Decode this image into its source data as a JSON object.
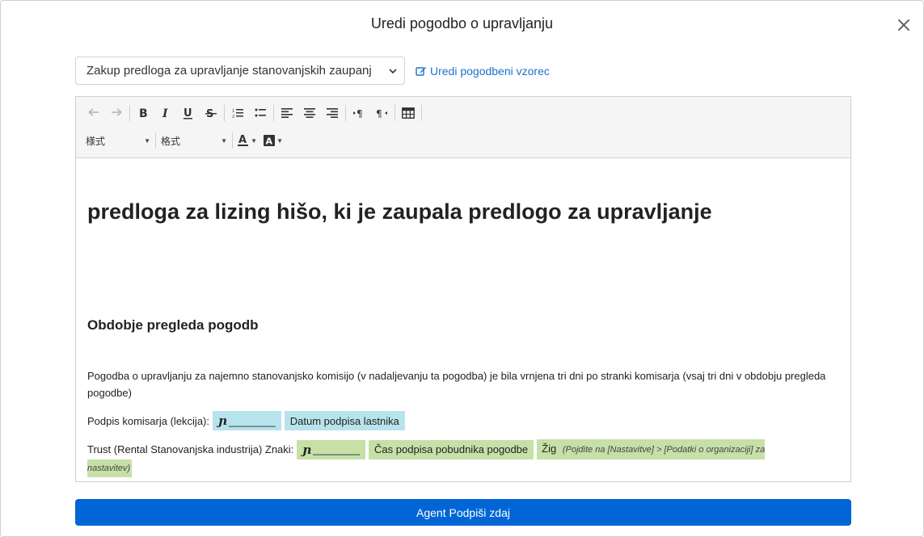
{
  "modal": {
    "title": "Uredi pogodbo o upravljanju",
    "close_icon": "close-icon"
  },
  "template_select": {
    "value": "Zakup predloga za upravljanje stanovanjskih zaupanj",
    "caret_icon": "chevron-down-icon"
  },
  "edit_template_link": {
    "label": "Uredi pogodbeni vzorec",
    "icon": "edit-icon"
  },
  "toolbar": {
    "style_combo": "様式",
    "format_combo": "格式"
  },
  "document": {
    "title": "predloga za lizing hišo, ki je zaupala predlogo za upravljanje",
    "section_heading": "Obdobje pregleda pogodb",
    "paragraph": "Pogodba o upravljanju za najemno stanovanjsko komisijo (v nadaljevanju ta pogodba) je bila vrnjena tri dni po stranki komisarja (vsaj tri dni v obdobju pregleda pogodbe)",
    "line1": {
      "label": "Podpis komisarja (lekcija):",
      "signature_blank": "________",
      "date_field": "Datum podpisa lastnika"
    },
    "line2": {
      "label": "Trust (Rental Stanovanjska industrija) Znaki:",
      "signature_blank": "________",
      "time_field": "Čas podpisa pobudnika pogodbe",
      "seal_label": "Žig",
      "seal_note_part1": "(Pojdite na [Nastavitve] > [Podatki o organizaciji] za",
      "seal_note_part2": "nastavitev)"
    }
  },
  "submit_button": {
    "label": "Agent Podpiši zdaj"
  },
  "colors": {
    "primary": "#0066d6",
    "link": "#1a73c8",
    "field_cyan": "#b7e4ec",
    "field_green": "#c6e0a8"
  }
}
